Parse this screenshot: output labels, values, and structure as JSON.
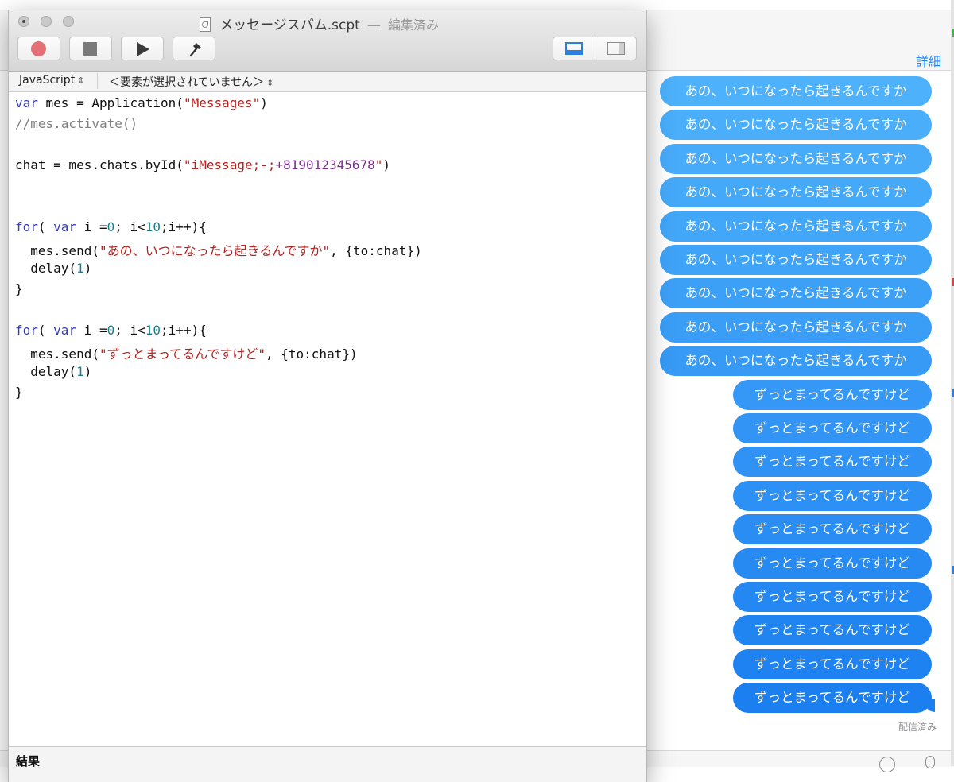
{
  "messages_app": {
    "details_label": "詳細",
    "bubbles_first": [
      "あの、いつになったら起きるんですか",
      "あの、いつになったら起きるんですか",
      "あの、いつになったら起きるんですか",
      "あの、いつになったら起きるんですか",
      "あの、いつになったら起きるんですか",
      "あの、いつになったら起きるんですか",
      "あの、いつになったら起きるんですか",
      "あの、いつになったら起きるんですか",
      "あの、いつになったら起きるんですか"
    ],
    "bubbles_second": [
      "ずっとまってるんですけど",
      "ずっとまってるんですけど",
      "ずっとまってるんですけど",
      "ずっとまってるんですけど",
      "ずっとまってるんですけど",
      "ずっとまってるんですけど",
      "ずっとまってるんですけど",
      "ずっとまってるんですけど",
      "ずっとまってるんですけど",
      "ずっとまってるんですけど"
    ],
    "delivered_label": "配信済み",
    "bubble_color_light": "#4db1fb",
    "bubble_color_dark": "#1c7ff0"
  },
  "script_editor": {
    "document_title": "メッセージスパム.scpt",
    "title_separator": "—",
    "edit_state": "編集済み",
    "icons": {
      "record": "record-icon",
      "stop": "stop-icon",
      "run": "play-icon",
      "compile": "hammer-icon",
      "bottom_pane": "bottom-pane-icon",
      "side_pane": "side-pane-icon"
    },
    "language_selector": "JavaScript",
    "element_selector": "＜要素が選択されていません＞",
    "code_lines": [
      [
        {
          "t": "var",
          "c": "kw"
        },
        {
          "t": " mes = Application(",
          "c": ""
        },
        {
          "t": "\"Messages\"",
          "c": "str"
        },
        {
          "t": ")",
          "c": ""
        }
      ],
      [
        {
          "t": "//mes.activate()",
          "c": "cmt"
        }
      ],
      [],
      [
        {
          "t": "chat = mes.chats.byId(",
          "c": ""
        },
        {
          "t": "\"iMessage;-;",
          "c": "str"
        },
        {
          "t": "+819012345678",
          "c": "id"
        },
        {
          "t": "\"",
          "c": "str"
        },
        {
          "t": ")",
          "c": ""
        }
      ],
      [],
      [],
      [
        {
          "t": "for",
          "c": "kw"
        },
        {
          "t": "( ",
          "c": ""
        },
        {
          "t": "var",
          "c": "kw"
        },
        {
          "t": " i =",
          "c": ""
        },
        {
          "t": "0",
          "c": "num"
        },
        {
          "t": "; i<",
          "c": ""
        },
        {
          "t": "10",
          "c": "num"
        },
        {
          "t": ";i++){",
          "c": ""
        }
      ],
      [
        {
          "t": "  mes.send(",
          "c": ""
        },
        {
          "t": "\"あの、いつになったら起きるんですか\"",
          "c": "str"
        },
        {
          "t": ", {to:chat})",
          "c": ""
        }
      ],
      [
        {
          "t": "  delay(",
          "c": ""
        },
        {
          "t": "1",
          "c": "num"
        },
        {
          "t": ")",
          "c": ""
        }
      ],
      [
        {
          "t": "}",
          "c": ""
        }
      ],
      [],
      [
        {
          "t": "for",
          "c": "kw"
        },
        {
          "t": "( ",
          "c": ""
        },
        {
          "t": "var",
          "c": "kw"
        },
        {
          "t": " i =",
          "c": ""
        },
        {
          "t": "0",
          "c": "num"
        },
        {
          "t": "; i<",
          "c": ""
        },
        {
          "t": "10",
          "c": "num"
        },
        {
          "t": ";i++){",
          "c": ""
        }
      ],
      [
        {
          "t": "  mes.send(",
          "c": ""
        },
        {
          "t": "\"ずっとまってるんですけど\"",
          "c": "str"
        },
        {
          "t": ", {to:chat})",
          "c": ""
        }
      ],
      [
        {
          "t": "  delay(",
          "c": ""
        },
        {
          "t": "1",
          "c": "num"
        },
        {
          "t": ")",
          "c": ""
        }
      ],
      [
        {
          "t": "}",
          "c": ""
        }
      ]
    ],
    "result_label": "結果"
  }
}
